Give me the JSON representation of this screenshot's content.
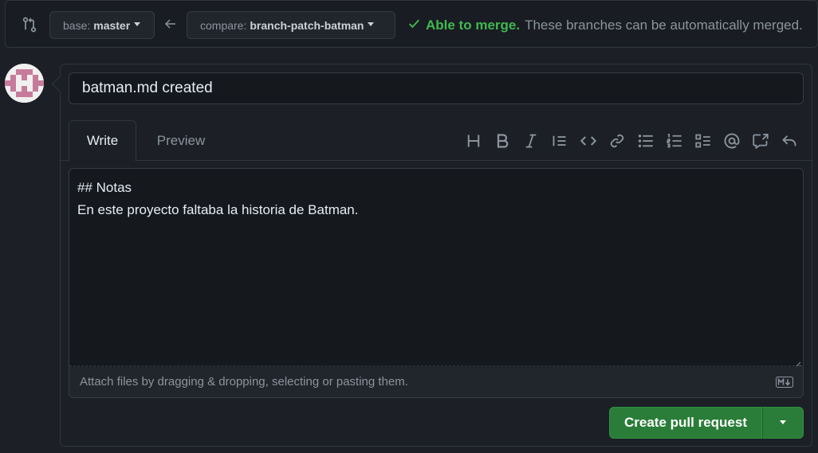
{
  "compare_bar": {
    "base_prefix": "base:",
    "base_branch": "master",
    "compare_prefix": "compare:",
    "compare_branch": "branch-patch-batman",
    "merge_ok": "Able to merge.",
    "merge_desc": "These branches can be automatically merged."
  },
  "form": {
    "title_value": "batman.md created",
    "tabs": [
      {
        "label": "Write",
        "active": true
      },
      {
        "label": "Preview",
        "active": false
      }
    ],
    "toolbar_icons": [
      "heading-icon",
      "bold-icon",
      "italic-icon",
      "quote-icon",
      "code-icon",
      "link-icon",
      "bulleted-list-icon",
      "numbered-list-icon",
      "task-list-icon",
      "mention-icon",
      "cross-reference-icon",
      "reply-icon"
    ],
    "body_value": "## Notas\nEn este proyecto faltaba la historia de Batman.",
    "attach_text": "Attach files by dragging & dropping, selecting or pasting them.",
    "create_button": "Create pull request"
  },
  "colors": {
    "background": "#1c1f26",
    "success_green": "#3fb950",
    "primary_button": "#2a7d38"
  }
}
